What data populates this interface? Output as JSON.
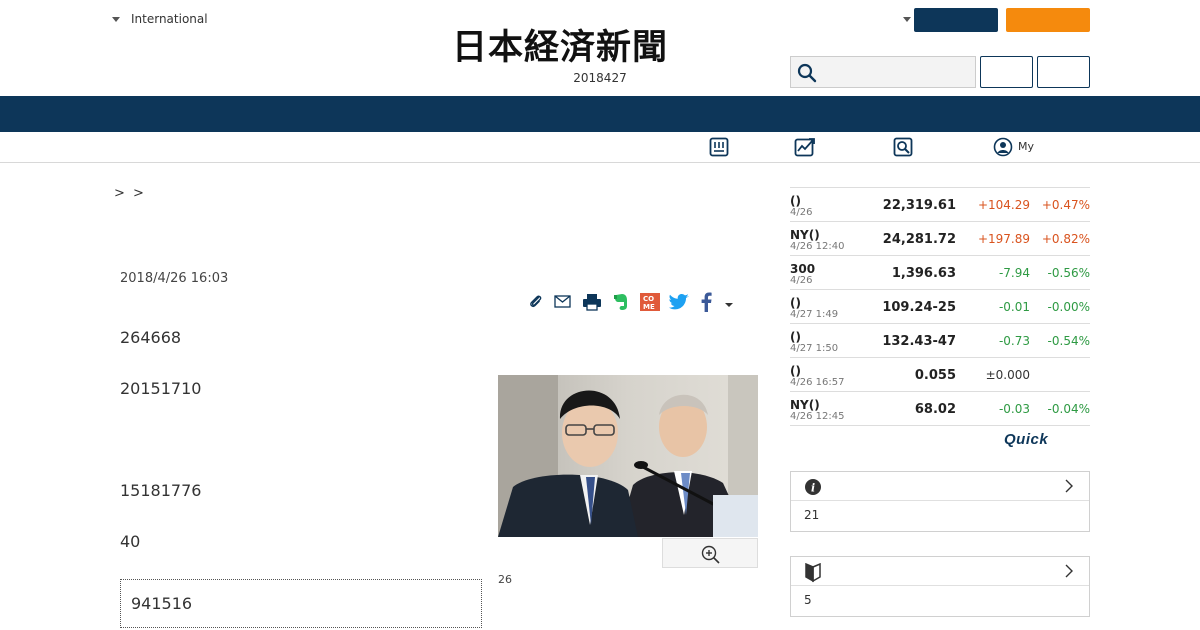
{
  "header": {
    "edition_label": "International",
    "logo_text": "日本経済新聞",
    "date": "2018427"
  },
  "subnav": {
    "my_label": "My",
    "icons": [
      "paper-icon",
      "chart-icon",
      "magnifier-doc-icon",
      "user-icon"
    ]
  },
  "breadcrumb": "> >",
  "article": {
    "date": "2018/4/26 16:03",
    "paragraphs": [
      "264668",
      "20151710",
      "15181776",
      "40"
    ],
    "quote": "941516",
    "photo_caption": "26"
  },
  "share_icons": [
    "clip-icon",
    "mail-icon",
    "print-icon",
    "evernote-icon",
    "come-icon",
    "twitter-icon",
    "facebook-icon",
    "more-caret-icon"
  ],
  "market": {
    "rows": [
      {
        "name": "()",
        "time": "4/26",
        "value": "22,319.61",
        "change": "+104.29",
        "pct": "+0.47%",
        "dir": "up"
      },
      {
        "name": "NY()",
        "time": "4/26 12:40",
        "value": "24,281.72",
        "change": "+197.89",
        "pct": "+0.82%",
        "dir": "up"
      },
      {
        "name": "300",
        "time": "4/26",
        "value": "1,396.63",
        "change": "-7.94",
        "pct": "-0.56%",
        "dir": "down"
      },
      {
        "name": "()",
        "time": "4/27 1:49",
        "value": "109.24-25",
        "change": "-0.01",
        "pct": "-0.00%",
        "dir": "down"
      },
      {
        "name": "()",
        "time": "4/27 1:50",
        "value": "132.43-47",
        "change": "-0.73",
        "pct": "-0.54%",
        "dir": "down"
      },
      {
        "name": "()",
        "time": "4/26 16:57",
        "value": "0.055",
        "change": "±0.000",
        "pct": "",
        "dir": "flat"
      },
      {
        "name": "NY()",
        "time": "4/26 12:45",
        "value": "68.02",
        "change": "-0.03",
        "pct": "-0.04%",
        "dir": "down"
      }
    ],
    "brand": "Quick"
  },
  "sideboxes": [
    {
      "icon": "info-icon",
      "body": "21"
    },
    {
      "icon": "beginner-mark-icon",
      "body": "5"
    }
  ],
  "colors": {
    "navy": "#0d3659",
    "orange": "#f58a0d",
    "up": "#d9531e",
    "down": "#2e9a43"
  }
}
